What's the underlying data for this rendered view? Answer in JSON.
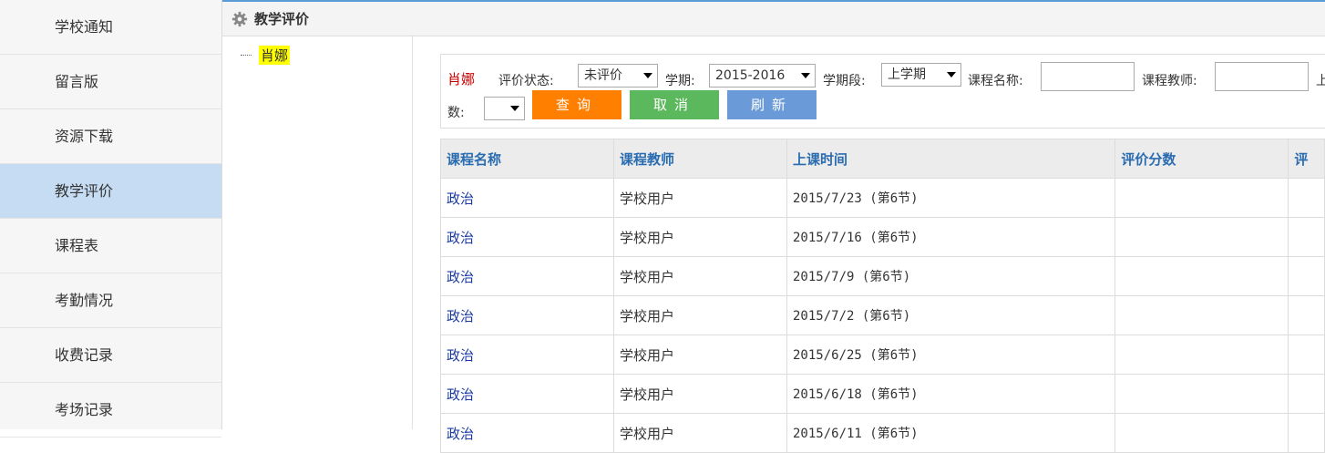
{
  "sidebar": {
    "items": [
      {
        "label": "学校通知"
      },
      {
        "label": "留言版"
      },
      {
        "label": "资源下载"
      },
      {
        "label": "教学评价",
        "active": true
      },
      {
        "label": "课程表"
      },
      {
        "label": "考勤情况"
      },
      {
        "label": "收费记录"
      },
      {
        "label": "考场记录"
      }
    ]
  },
  "header": {
    "title": "教学评价",
    "icon": "gear-icon"
  },
  "tree": {
    "node_label": "肖娜"
  },
  "filter": {
    "student_name": "肖娜",
    "status_label": "评价状态:",
    "status_value": "未评价",
    "term_label": "学期:",
    "term_value": "2015-2016",
    "semester_label": "学期段:",
    "semester_value": "上学期",
    "course_label": "课程名称:",
    "course_value": "",
    "teacher_label": "课程教师:",
    "teacher_value": "",
    "truncated_label": "上",
    "score_label": "数:",
    "score_value": "",
    "query_button": "查询",
    "cancel_button": "取消",
    "refresh_button": "刷新"
  },
  "colors": {
    "query": "#ff7f00",
    "cancel": "#5cb85c",
    "refresh": "#6a9bd8",
    "active_sidebar": "#c6dcf3"
  },
  "table": {
    "headers": [
      "课程名称",
      "课程教师",
      "上课时间",
      "评价分数",
      "评"
    ],
    "rows": [
      [
        "政治",
        "学校用户",
        "2015/7/23 (第6节)",
        ""
      ],
      [
        "政治",
        "学校用户",
        "2015/7/16 (第6节)",
        ""
      ],
      [
        "政治",
        "学校用户",
        "2015/7/9 (第6节)",
        ""
      ],
      [
        "政治",
        "学校用户",
        "2015/7/2 (第6节)",
        ""
      ],
      [
        "政治",
        "学校用户",
        "2015/6/25 (第6节)",
        ""
      ],
      [
        "政治",
        "学校用户",
        "2015/6/18 (第6节)",
        ""
      ],
      [
        "政治",
        "学校用户",
        "2015/6/11 (第6节)",
        ""
      ]
    ]
  }
}
